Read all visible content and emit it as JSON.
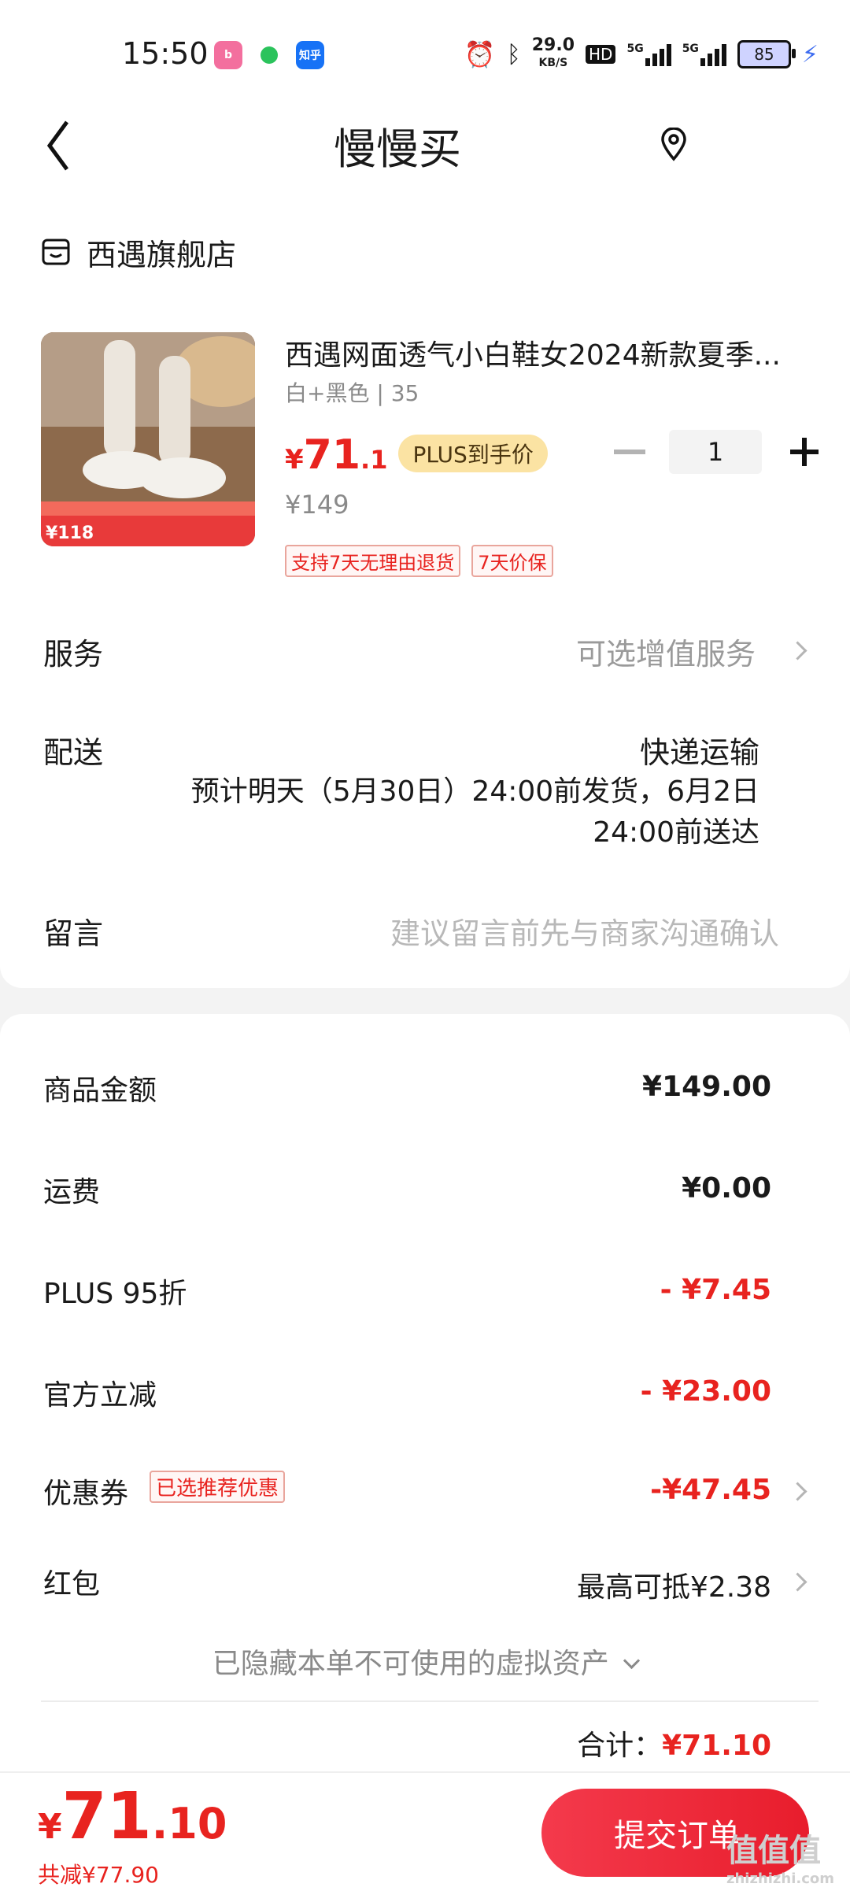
{
  "status_bar": {
    "time": "15:50",
    "apps": [
      "bilibili",
      "wechat-like",
      "知乎"
    ],
    "net_speed": "29.0",
    "net_unit": "KB/S",
    "hd": "HD",
    "sig1": "5G",
    "sig2": "5G",
    "battery": "85"
  },
  "header": {
    "title": "慢慢买"
  },
  "store": {
    "name": "西遇旗舰店"
  },
  "product": {
    "title": "西遇网面透气小白鞋女2024新款夏季...",
    "sku": "白+黑色 | 35",
    "price_symbol": "¥",
    "price_int": "71",
    "price_dec": ".1",
    "plus_badge": "PLUS到手价",
    "original_price": "¥149",
    "tags": [
      "支持7天无理由退货",
      "7天价保"
    ],
    "quantity": "1",
    "image_overlay": "¥118"
  },
  "service": {
    "label": "服务",
    "value": "可选增值服务"
  },
  "delivery": {
    "label": "配送",
    "method": "快递运输",
    "estimate": "预计明天（5月30日）24:00前发货，6月2日24:00前送达"
  },
  "message": {
    "label": "留言",
    "placeholder": "建议留言前先与商家沟通确认"
  },
  "summary": {
    "items": [
      {
        "label": "商品金额",
        "value": "¥149.00"
      },
      {
        "label": "运费",
        "value": "¥0.00"
      },
      {
        "label": "PLUS 95折",
        "value": "- ¥7.45"
      },
      {
        "label": "官方立减",
        "value": "- ¥23.00"
      },
      {
        "label": "优惠券",
        "value": "-¥47.45",
        "tag": "已选推荐优惠"
      },
      {
        "label": "红包",
        "value": "最高可抵¥2.38"
      }
    ],
    "hidden_note": "已隐藏本单不可使用的虚拟资产",
    "total_label": "合计：",
    "total_value": "¥71.10"
  },
  "bottom_bar": {
    "symbol": "¥",
    "int": "71",
    "dec": ".10",
    "saved": "共减¥77.90",
    "submit": "提交订单"
  },
  "watermark": {
    "text": "值值值",
    "sub": "zhizhizhi.com"
  },
  "colors": {
    "accent_red": "#e8231f",
    "plus_gold": "#fbe3a3"
  }
}
